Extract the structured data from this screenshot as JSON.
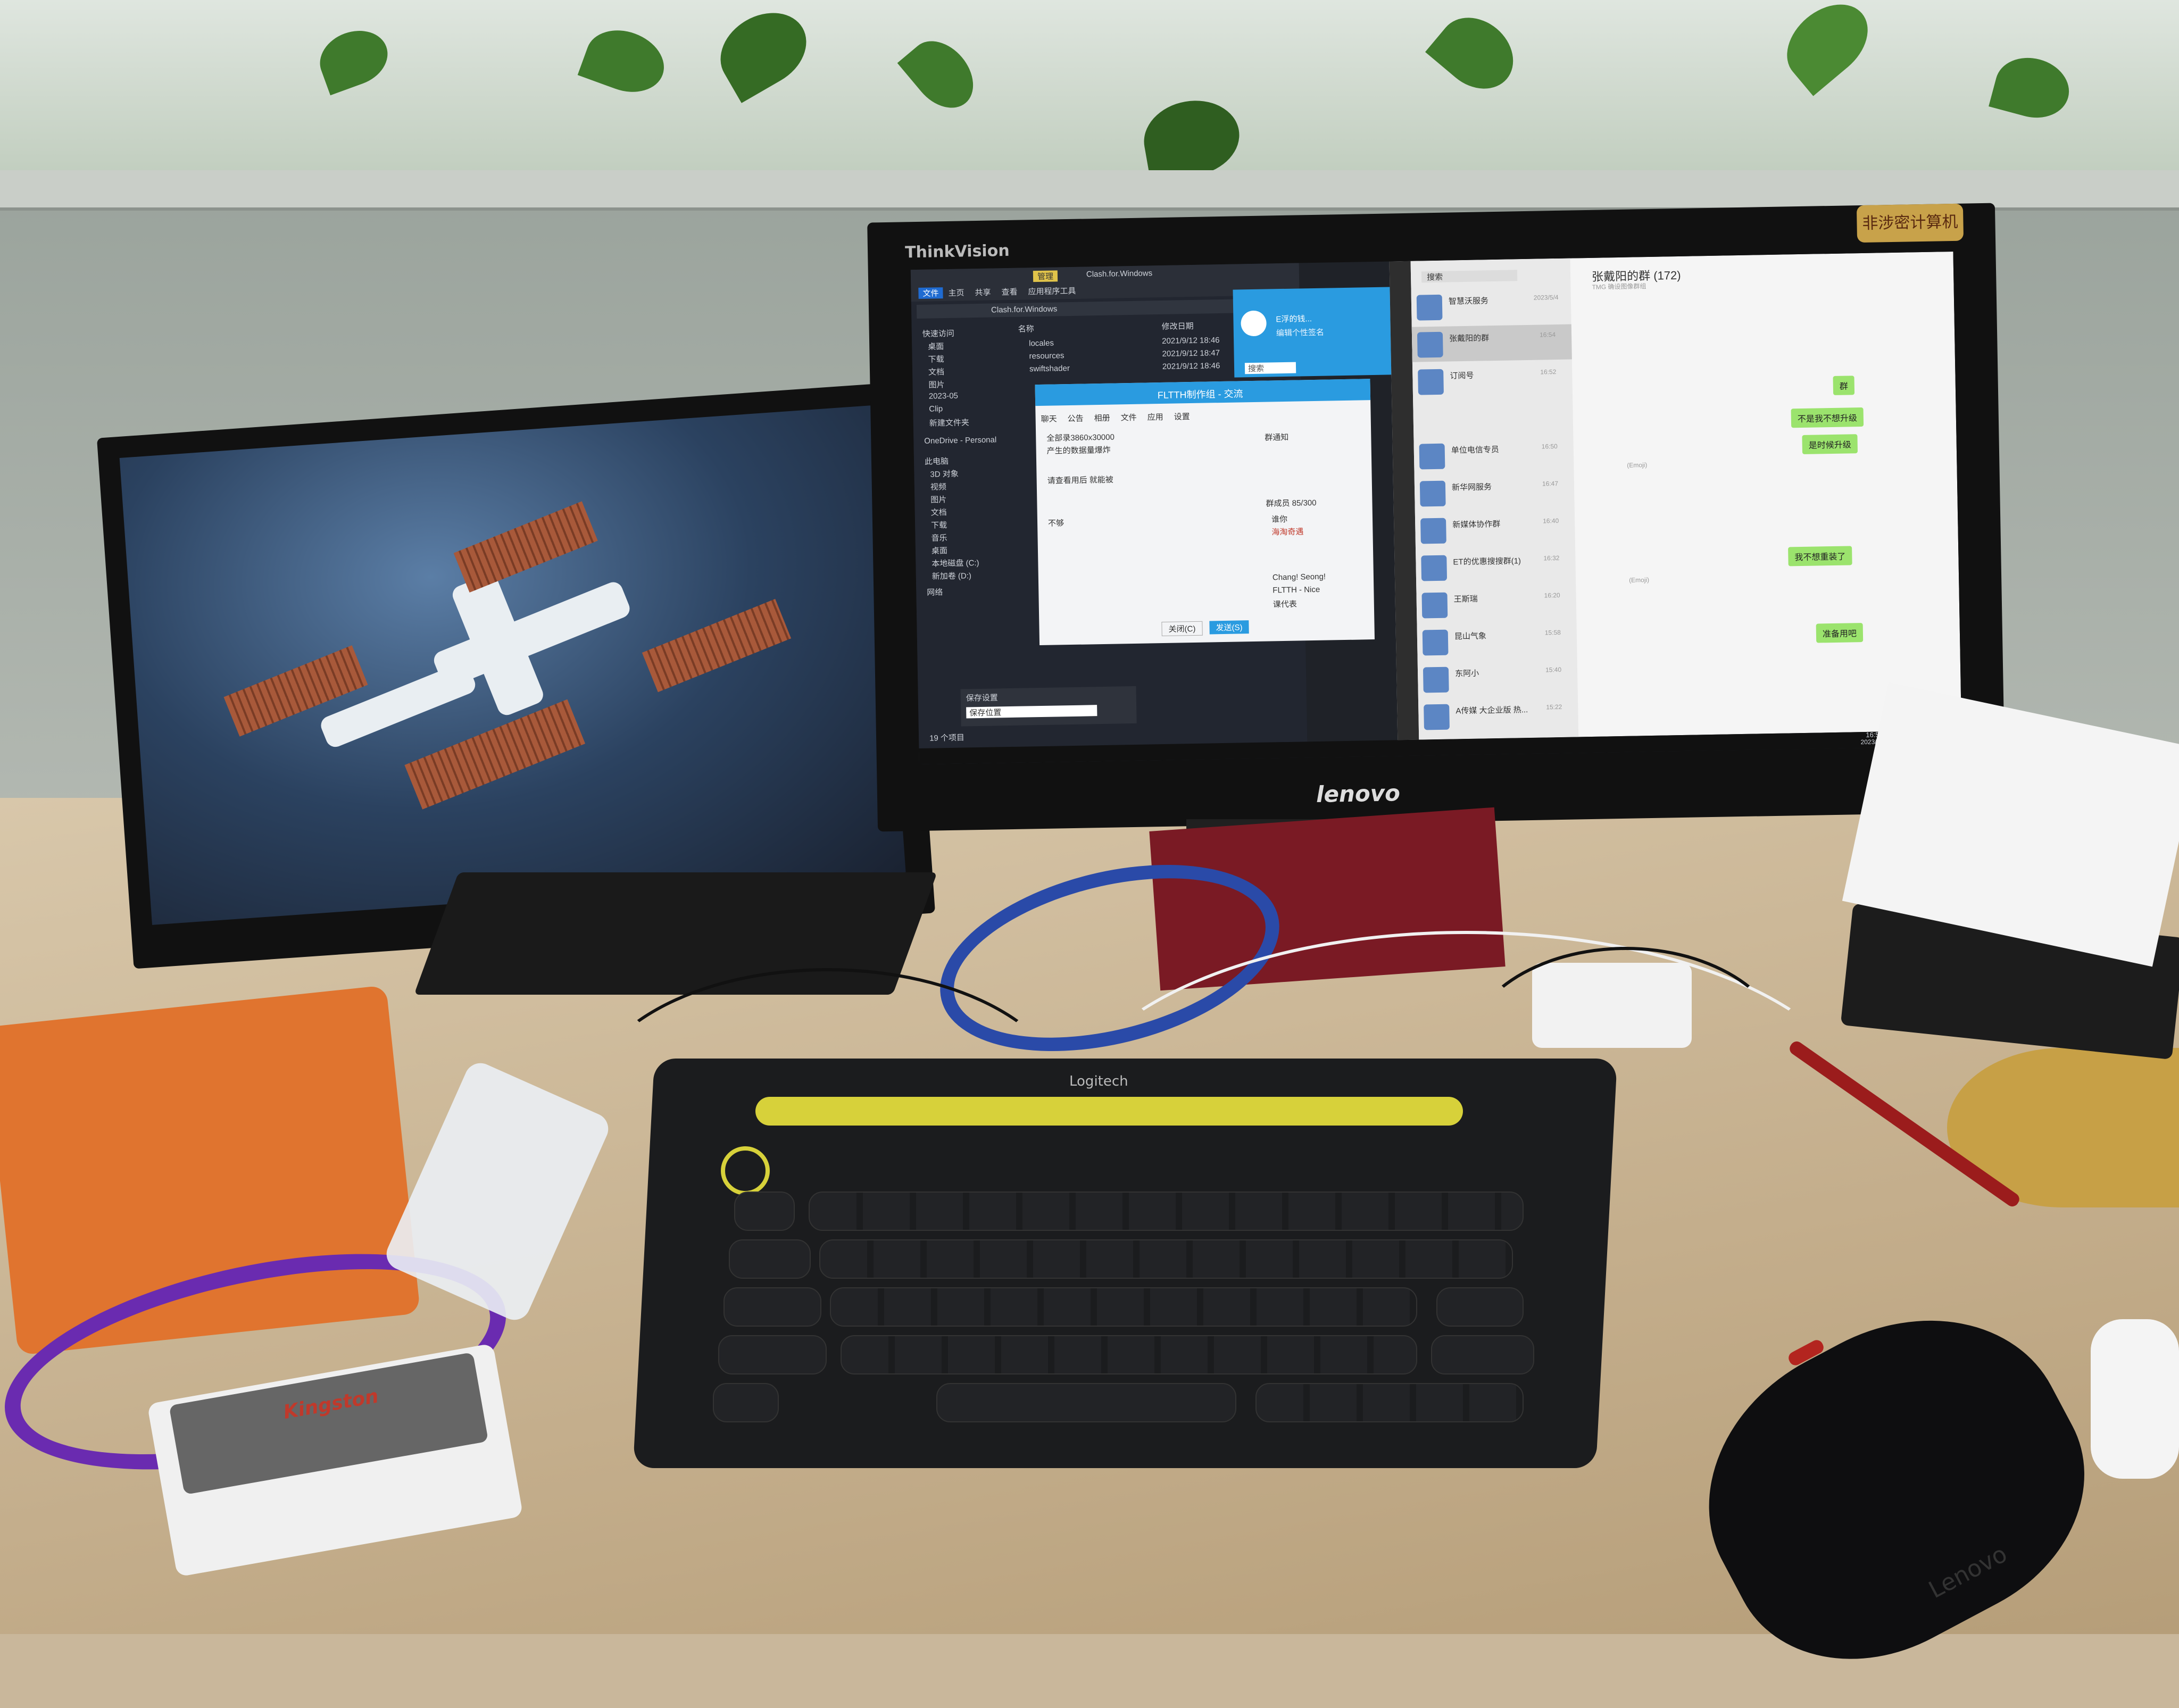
{
  "scene": {
    "left_monitor": {
      "brand": ""
    },
    "right_monitor": {
      "top_brand": "ThinkVision",
      "bottom_brand": "lenovo",
      "sticker": "非涉密计算机"
    },
    "keyboard": {
      "brand": "Logitech"
    },
    "mouse": {
      "brand": "Lenovo"
    },
    "card_reader": {
      "brand": "Kingston"
    }
  },
  "file_explorer": {
    "ribbon_tabs": [
      "文件",
      "主页",
      "共享",
      "查看",
      "应用程序工具"
    ],
    "manage_tab": "管理",
    "title": "Clash.for.Windows",
    "path": "Clash.for.Windows",
    "columns": [
      "名称",
      "修改日期"
    ],
    "files": [
      {
        "name": "locales",
        "date": "2021/9/12 18:46"
      },
      {
        "name": "resources",
        "date": "2021/9/12 18:47"
      },
      {
        "name": "swiftshader",
        "date": "2021/9/12 18:46"
      }
    ],
    "nav_items": [
      "快速访问",
      "桌面",
      "下载",
      "文档",
      "图片",
      "2023-05",
      "Clip",
      "新建文件夹",
      "OneDrive - Personal",
      "此电脑",
      "3D 对象",
      "视频",
      "图片",
      "文档",
      "下载",
      "音乐",
      "桌面",
      "本地磁盘 (C:)",
      "新加卷 (D:)",
      "网络"
    ],
    "status": "19 个项目"
  },
  "chat_window": {
    "title": "FLTTH制作组 - 交流",
    "tabs": [
      "聊天",
      "公告",
      "相册",
      "文件",
      "应用",
      "设置"
    ],
    "messages": [
      "全部录3860x30000",
      "产生的数据量爆炸",
      "请查看用后 就能被",
      "不够"
    ],
    "notice_label": "群通知",
    "members_label": "群成员 85/300",
    "members": [
      "谁你",
      "海淘奇遇",
      "Chang! Seong!",
      "FLTTH - Nice",
      "课代表"
    ],
    "buttons": [
      "关闭(C)",
      "发送(S)"
    ]
  },
  "qq_panel": {
    "name": "E浮的钱...",
    "status": "编辑个性签名",
    "search": "搜索"
  },
  "notification": {
    "title": "保存设置",
    "body": "保存位置"
  },
  "wechat": {
    "search_placeholder": "搜索",
    "group_title": "张戴阳的群 (172)",
    "group_subtitle": "TMG 确设图像群组",
    "chats": [
      {
        "name": "智慧沃服务",
        "time": "2023/5/4"
      },
      {
        "name": "张戴阳的群",
        "time": "16:54"
      },
      {
        "name": "订阅号",
        "time": "16:52"
      },
      {
        "name": "单位电信专员",
        "time": "16:50"
      },
      {
        "name": "新华网服务",
        "time": "16:47"
      },
      {
        "name": "新媒体协作群",
        "time": "16:40"
      },
      {
        "name": "ET的优惠搜搜群(1)",
        "time": "16:32"
      },
      {
        "name": "王斯瑞",
        "time": "16:20"
      },
      {
        "name": "昆山气象",
        "time": "15:58"
      },
      {
        "name": "东阿小",
        "time": "15:40"
      },
      {
        "name": "A传媒 大企业版 热...",
        "time": "15:22"
      }
    ],
    "bubbles_right": [
      "群",
      "不是我不想升级",
      "是时候升级",
      "我不想重装了",
      "准备用吧"
    ],
    "sender_labels": [
      "(Emoji)",
      "(Emoji)"
    ]
  },
  "taskbar": {
    "time": "16:54",
    "date": "2023/5/30"
  }
}
